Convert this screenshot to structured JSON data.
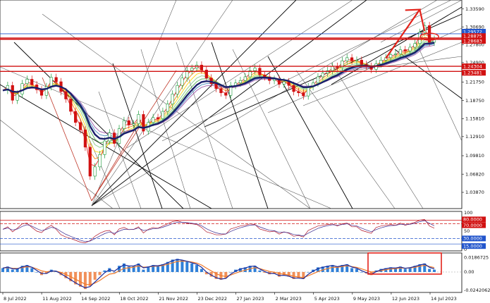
{
  "chart_data": [
    {
      "type": "line",
      "panel": "price",
      "x": [
        "8 Jul 2022",
        "11 Aug 2022",
        "14 Sep 2022",
        "18 Oct 2022",
        "21 Nov 2022",
        "23 Dec 2022",
        "27 Jan 2023",
        "2 Mar 2023",
        "5 Apr 2023",
        "9 May 2023",
        "12 Jun 2023",
        "14 Jul 2023"
      ],
      "ylim": [
        1.017,
        1.3459
      ],
      "y_ticks": [
        "1.33590",
        "1.30690",
        "1.27800",
        "1.24900",
        "1.21750",
        "1.18750",
        "1.15810",
        "1.12910",
        "1.09810",
        "1.06820",
        "1.03870"
      ],
      "level_tags": [
        {
          "label": "1.29572",
          "color": "#2255cc"
        },
        {
          "label": "1.28875",
          "color": "#d11111"
        },
        {
          "label": "1.28683",
          "color": "#d11111"
        },
        {
          "label": "1.24304",
          "color": "#d11111"
        },
        {
          "label": "1.23481",
          "color": "#d11111"
        }
      ],
      "close": [
        1.204,
        1.212,
        1.188,
        1.198,
        1.215,
        1.222,
        1.213,
        1.205,
        1.196,
        1.21,
        1.225,
        1.218,
        1.202,
        1.19,
        1.17,
        1.152,
        1.14,
        1.112,
        1.065,
        1.08,
        1.1,
        1.122,
        1.135,
        1.118,
        1.142,
        1.155,
        1.148,
        1.15,
        1.165,
        1.138,
        1.152,
        1.16,
        1.158,
        1.17,
        1.182,
        1.198,
        1.212,
        1.224,
        1.236,
        1.24,
        1.245,
        1.237,
        1.224,
        1.215,
        1.207,
        1.2,
        1.196,
        1.212,
        1.216,
        1.22,
        1.226,
        1.236,
        1.24,
        1.229,
        1.226,
        1.22,
        1.222,
        1.214,
        1.218,
        1.212,
        1.202,
        1.2,
        1.195,
        1.21,
        1.216,
        1.226,
        1.232,
        1.236,
        1.243,
        1.241,
        1.252,
        1.257,
        1.252,
        1.253,
        1.246,
        1.243,
        1.238,
        1.247,
        1.253,
        1.257,
        1.262,
        1.263,
        1.27,
        1.268,
        1.274,
        1.28,
        1.298,
        1.309,
        1.282,
        1.287
      ]
    },
    {
      "type": "line",
      "panel": "oscillator",
      "ylim": [
        0,
        100
      ],
      "y_ticks": [
        "100",
        "50",
        "0"
      ],
      "level_tags": [
        {
          "label": "80.0000",
          "color": "#d11111"
        },
        {
          "label": "70.0000",
          "color": "#d11111"
        },
        {
          "label": "30.0000",
          "color": "#2255cc"
        },
        {
          "label": "15.0000",
          "color": "#2255cc"
        }
      ],
      "values": [
        55,
        62,
        48,
        58,
        70,
        72,
        60,
        50,
        46,
        58,
        66,
        55,
        40,
        34,
        30,
        25,
        20,
        18,
        24,
        36,
        44,
        50,
        52,
        40,
        56,
        60,
        54,
        55,
        62,
        45,
        55,
        60,
        58,
        64,
        70,
        76,
        78,
        74,
        72,
        70,
        68,
        60,
        48,
        44,
        40,
        40,
        42,
        56,
        60,
        64,
        66,
        70,
        68,
        56,
        52,
        48,
        50,
        42,
        48,
        44,
        36,
        38,
        34,
        52,
        58,
        64,
        66,
        68,
        70,
        64,
        70,
        72,
        62,
        62,
        52,
        48,
        44,
        60,
        64,
        66,
        68,
        66,
        72,
        66,
        70,
        74,
        80,
        82,
        64,
        58
      ]
    },
    {
      "type": "bar",
      "panel": "macd",
      "y_ticks": [
        "0.0186725",
        "0.00",
        "-0.0242062"
      ],
      "values": [
        0.005,
        0.007,
        0.003,
        0.004,
        0.008,
        0.009,
        0.005,
        0.0,
        -0.004,
        -0.002,
        0.003,
        0.001,
        -0.004,
        -0.008,
        -0.012,
        -0.016,
        -0.019,
        -0.022,
        -0.018,
        -0.01,
        -0.004,
        0.002,
        0.005,
        0.0,
        0.008,
        0.011,
        0.007,
        0.008,
        0.011,
        0.003,
        0.007,
        0.009,
        0.008,
        0.01,
        0.013,
        0.016,
        0.017,
        0.015,
        0.013,
        0.011,
        0.009,
        0.004,
        -0.003,
        -0.006,
        -0.009,
        -0.01,
        -0.008,
        0.0,
        0.003,
        0.005,
        0.006,
        0.008,
        0.008,
        0.002,
        -0.001,
        -0.003,
        -0.002,
        -0.006,
        -0.004,
        -0.006,
        -0.009,
        -0.008,
        -0.009,
        0.0,
        0.003,
        0.006,
        0.007,
        0.008,
        0.009,
        0.006,
        0.009,
        0.01,
        0.005,
        0.004,
        0.0,
        -0.002,
        -0.004,
        0.002,
        0.004,
        0.005,
        0.006,
        0.005,
        0.007,
        0.004,
        0.006,
        0.008,
        0.01,
        0.011,
        0.004,
        0.003
      ]
    }
  ],
  "colors": {
    "candle_up": "#1a9a3a",
    "candle_down": "#d11111",
    "main_ma": "#1a1f6b",
    "macd_pos": "#2f80d8",
    "macd_neg": "#f0905a",
    "annotation": "#e3231b",
    "level_blue": "#2255cc",
    "level_red": "#d11111"
  }
}
